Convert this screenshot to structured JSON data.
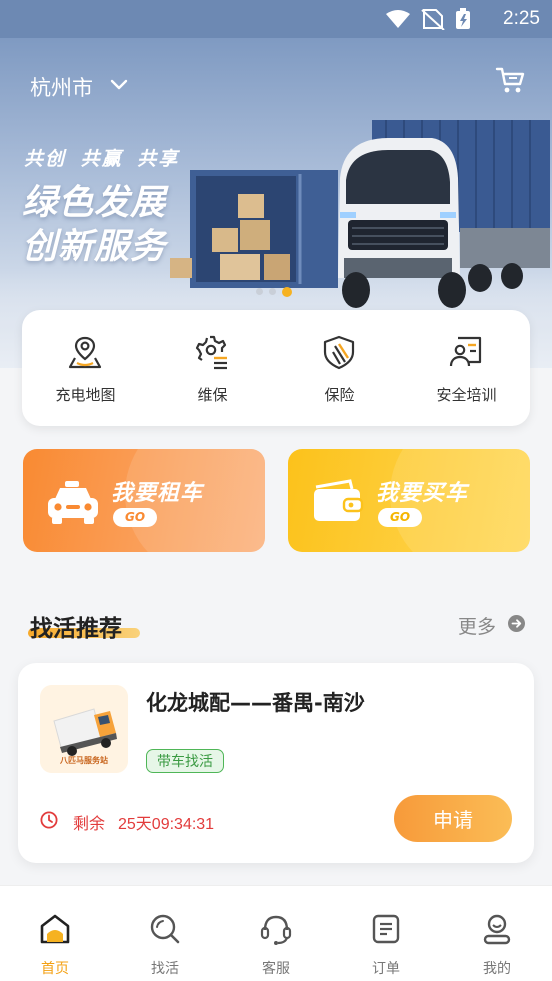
{
  "status_bar": {
    "time": "2:25"
  },
  "header": {
    "city": "杭州市"
  },
  "banner": {
    "slogan_small": "共创 共赢 共享",
    "slogan_line1": "绿色发展",
    "slogan_line2": "创新服务",
    "slide_count": 3,
    "active_slide": 3
  },
  "services": [
    {
      "label": "充电地图",
      "icon": "map-pin-icon"
    },
    {
      "label": "维保",
      "icon": "gear-list-icon"
    },
    {
      "label": "保险",
      "icon": "shield-icon"
    },
    {
      "label": "安全培训",
      "icon": "training-icon"
    }
  ],
  "actions": {
    "rent": {
      "title": "我要租车",
      "go": "GO",
      "icon": "car-icon"
    },
    "buy": {
      "title": "我要买车",
      "go": "GO",
      "icon": "wallet-icon"
    }
  },
  "section": {
    "title": "找活推荐",
    "more": "更多"
  },
  "job": {
    "title": "化龙城配——番禺-南沙",
    "tag": "带车找活",
    "thumb_text": "八匹马服务站",
    "remaining_label": "剩余",
    "remaining_value": "25天09:34:31",
    "apply": "申请"
  },
  "tabs": [
    {
      "label": "首页",
      "icon": "home-icon",
      "active": true
    },
    {
      "label": "找活",
      "icon": "search-icon",
      "active": false
    },
    {
      "label": "客服",
      "icon": "headset-icon",
      "active": false
    },
    {
      "label": "订单",
      "icon": "order-icon",
      "active": false
    },
    {
      "label": "我的",
      "icon": "user-icon",
      "active": false
    }
  ],
  "colors": {
    "accent_orange": "#f98a32",
    "accent_yellow": "#fcc21b",
    "active_tab": "#f4a114",
    "countdown_red": "#e23c3c",
    "tag_green": "#3a9a42"
  }
}
